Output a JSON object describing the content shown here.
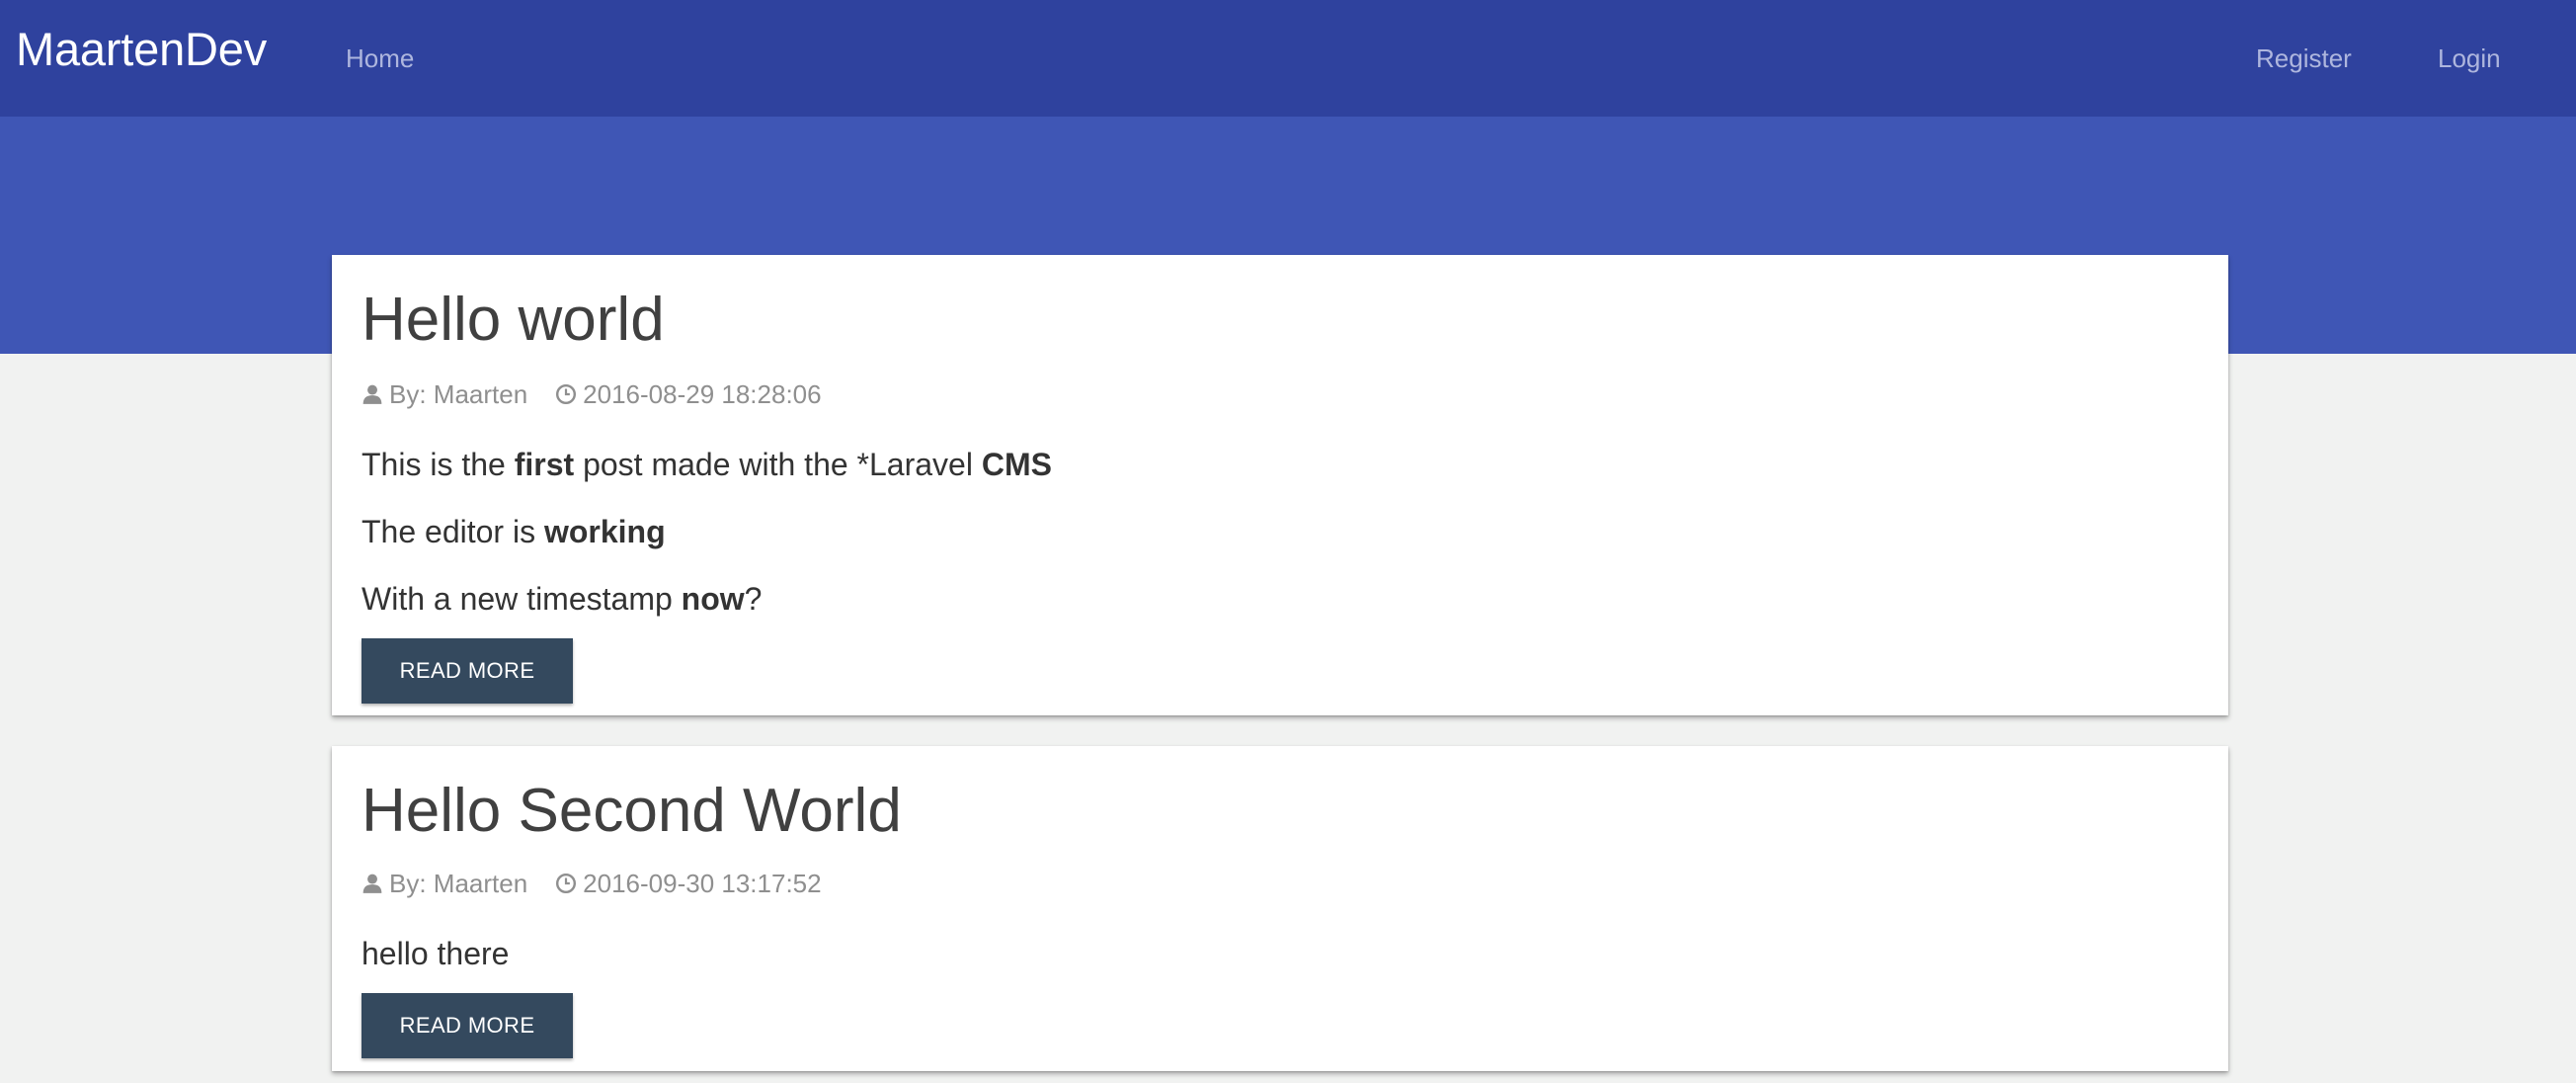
{
  "navbar": {
    "brand": "MaartenDev",
    "home": "Home",
    "register": "Register",
    "login": "Login"
  },
  "posts": [
    {
      "title": "Hello world",
      "author": "By: Maarten",
      "timestamp": "2016-08-29 18:28:06",
      "lines": [
        {
          "a": "This is the ",
          "b": "first",
          "c": " post made with the *Laravel ",
          "d": "CMS",
          "e": ""
        },
        {
          "a": "The editor is ",
          "b": "working",
          "c": "",
          "d": "",
          "e": ""
        },
        {
          "a": "With a new timestamp ",
          "b": "now",
          "c": "?",
          "d": "",
          "e": ""
        }
      ],
      "button": "Read more"
    },
    {
      "title": "Hello Second World",
      "author": "By: Maarten",
      "timestamp": "2016-09-30 13:17:52",
      "lines": [
        {
          "a": "hello there"
        }
      ],
      "button": "Read more"
    }
  ],
  "icons": {
    "author": "user-icon",
    "timestamp": "clock-icon"
  },
  "colors": {
    "navbar": "#2f429e",
    "hero": "#3f56b5",
    "button": "#34495e",
    "page_background": "#f1f2f1"
  }
}
